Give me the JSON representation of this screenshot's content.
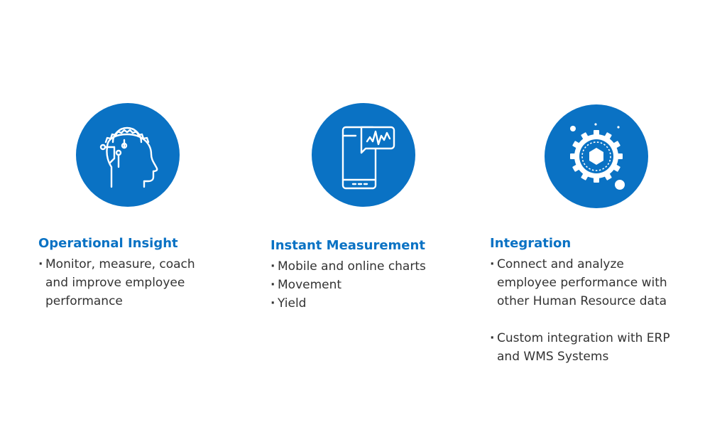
{
  "colors": {
    "accent": "#0a72c4",
    "text": "#333333",
    "icon_stroke": "#ffffff"
  },
  "features": [
    {
      "icon": "ai-head-gear-icon",
      "title": "Operational Insight",
      "bullets": [
        "Monitor, measure, coach\nand improve employee\nperformance"
      ]
    },
    {
      "icon": "mobile-chart-icon",
      "title": "Instant Measurement",
      "bullets": [
        "Mobile and online charts",
        "Movement",
        "Yield"
      ]
    },
    {
      "icon": "integration-gear-icon",
      "title": "Integration",
      "bullets": [
        "Connect and analyze\nemployee performance with\nother Human Resource data",
        "Custom integration with ERP\nand WMS Systems"
      ]
    }
  ]
}
